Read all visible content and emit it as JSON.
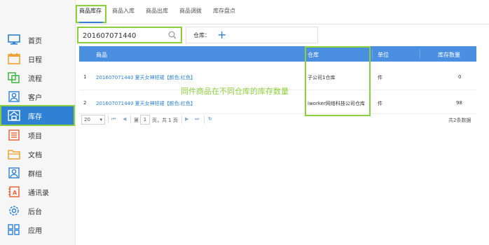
{
  "sidebar": {
    "items": [
      {
        "label": "首页",
        "icon": "monitor-icon"
      },
      {
        "label": "日程",
        "icon": "calendar-icon"
      },
      {
        "label": "流程",
        "icon": "flow-icon"
      },
      {
        "label": "客户",
        "icon": "customer-icon"
      },
      {
        "label": "库存",
        "icon": "warehouse-icon",
        "active": true
      },
      {
        "label": "项目",
        "icon": "project-icon"
      },
      {
        "label": "文档",
        "icon": "folder-icon"
      },
      {
        "label": "群组",
        "icon": "group-icon"
      },
      {
        "label": "通讯录",
        "icon": "address-book-icon"
      },
      {
        "label": "后台",
        "icon": "gear-icon"
      },
      {
        "label": "应用",
        "icon": "apps-icon"
      }
    ]
  },
  "tabs": [
    {
      "label": "商品库存",
      "active": true
    },
    {
      "label": "商品入库"
    },
    {
      "label": "商品出库"
    },
    {
      "label": "商品调拨"
    },
    {
      "label": "库存盘点"
    }
  ],
  "search": {
    "value": "201607071440"
  },
  "warehouse_filter": {
    "label": "仓库：",
    "add_symbol": "+"
  },
  "table": {
    "columns": [
      "商品",
      "仓库",
      "单位",
      "库存数量"
    ],
    "rows": [
      {
        "index": "1",
        "product": "201607071440 夏天女神短裙【颜色:红色】",
        "warehouse": "子公司1仓库",
        "unit": "件",
        "qty": "0"
      },
      {
        "index": "2",
        "product": "201607071440 夏天女神短裙【颜色:红色】",
        "warehouse": "iworker网络科技公司仓库",
        "unit": "件",
        "qty": "98"
      }
    ]
  },
  "annotation": "同件商品在不同仓库的库存数量",
  "pager": {
    "page_size": "20",
    "page_prefix": "第",
    "page_value": "1",
    "page_suffix": "页，共 1 页",
    "total": "共2条数据"
  },
  "colors": {
    "accent": "#2f81d4",
    "header": "#4a8fe0",
    "highlight": "#8ccf3c"
  }
}
